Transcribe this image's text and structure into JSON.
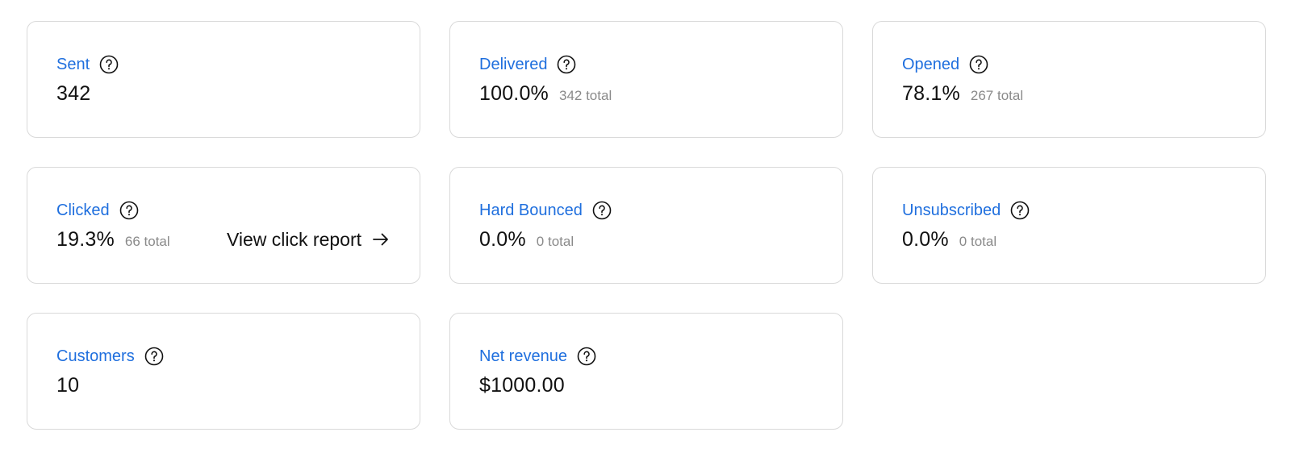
{
  "cards": [
    {
      "label": "Sent",
      "value": "342",
      "sub": ""
    },
    {
      "label": "Delivered",
      "value": "100.0%",
      "sub": "342 total"
    },
    {
      "label": "Opened",
      "value": "78.1%",
      "sub": "267 total"
    },
    {
      "label": "Clicked",
      "value": "19.3%",
      "sub": "66 total",
      "link": "View click report"
    },
    {
      "label": "Hard Bounced",
      "value": "0.0%",
      "sub": "0 total"
    },
    {
      "label": "Unsubscribed",
      "value": "0.0%",
      "sub": "0 total"
    },
    {
      "label": "Customers",
      "value": "10",
      "sub": ""
    },
    {
      "label": "Net revenue",
      "value": "$1000.00",
      "sub": ""
    }
  ],
  "icons": {
    "help": "question-circle-icon",
    "link_arrow": "arrow-right-icon"
  },
  "colors": {
    "label": "#1f6fde",
    "value": "#111111",
    "sub": "#8a8a8a",
    "border": "#d9d9d9"
  }
}
